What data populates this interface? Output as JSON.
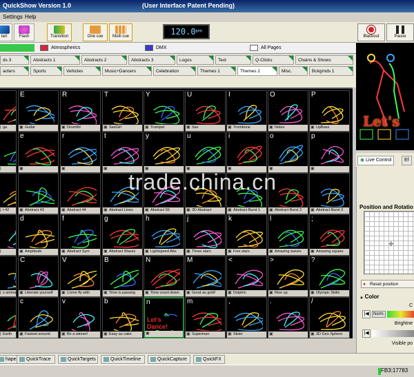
{
  "app": {
    "title": "QuickShow   Version 1.0",
    "subtitle": "(User Interface Patent Pending)"
  },
  "menu": [
    "Settings",
    "Help"
  ],
  "toolbar": {
    "buttons": [
      {
        "label": "tart",
        "icon": "start-icon"
      },
      {
        "label": "Flash",
        "icon": "flash-icon"
      },
      {
        "label": "Transition",
        "icon": "transition-icon"
      },
      {
        "label": "One cue",
        "icon": "one-cue-icon"
      },
      {
        "label": "Multi cue",
        "icon": "multi-cue-icon"
      }
    ],
    "bpm": "120.0",
    "bpm_unit": "BPM"
  },
  "right_buttons": [
    {
      "label": "Blackout",
      "icon": "blackout-icon"
    },
    {
      "label": "Pause",
      "icon": "pause-icon"
    }
  ],
  "categories": [
    {
      "label": "Atmospherics",
      "color": "#d22a3a"
    },
    {
      "label": "DMX",
      "color": "#3a3ac8"
    },
    {
      "label": "All Pages",
      "color": "#ffffff"
    }
  ],
  "tab_row1": [
    "ds 3",
    "Abstracts 1",
    "Abstracts 2",
    "Abstracts 3",
    "Logos",
    "Text",
    "Q-Clicks",
    "Chains & Shows"
  ],
  "tab_row2": [
    "acters",
    "Sports",
    "Vehicles",
    "Music+Dancers",
    "Celebration",
    "Themes 1",
    "Themes 2",
    "Misc.",
    "Bckgrnds 1"
  ],
  "active_tab": "Themes 2",
  "grid": [
    [
      {
        "key": "",
        "label": "ga"
      },
      {
        "key": "E",
        "label": "Guitar"
      },
      {
        "key": "R",
        "label": "DrumKit"
      },
      {
        "key": "T",
        "label": "SaxGirl"
      },
      {
        "key": "Y",
        "label": "Trumpet"
      },
      {
        "key": "U",
        "label": "Sax"
      },
      {
        "key": "I",
        "label": "Trombone"
      },
      {
        "key": "O",
        "label": "Notes"
      },
      {
        "key": "P",
        "label": "UpBass"
      }
    ],
    [
      {
        "key": "",
        "label": ""
      },
      {
        "key": "e",
        "label": ""
      },
      {
        "key": "r",
        "label": ""
      },
      {
        "key": "t",
        "label": ""
      },
      {
        "key": "y",
        "label": ""
      },
      {
        "key": "u",
        "label": ""
      },
      {
        "key": "i",
        "label": ""
      },
      {
        "key": "o",
        "label": ""
      },
      {
        "key": "p",
        "label": ""
      }
    ],
    [
      {
        "key": "",
        "label": "t 42"
      },
      {
        "key": "",
        "label": "Abstract 43"
      },
      {
        "key": "",
        "label": "Abstract 44"
      },
      {
        "key": "",
        "label": "Abstract Lines"
      },
      {
        "key": "",
        "label": "Abstract 56"
      },
      {
        "key": "",
        "label": "3D Abstract"
      },
      {
        "key": "",
        "label": "Abstract Burst 1"
      },
      {
        "key": "",
        "label": "Abstract Burst 2"
      },
      {
        "key": "",
        "label": "Abstract Burst 3"
      }
    ],
    [
      {
        "key": "",
        "label": ""
      },
      {
        "key": "d",
        "label": "Amplitude"
      },
      {
        "key": "f",
        "label": "Abstract Sym"
      },
      {
        "key": "g",
        "label": "Abstract Waves"
      },
      {
        "key": "h",
        "label": "Lightspeed Abs"
      },
      {
        "key": "j",
        "label": "Three stars"
      },
      {
        "key": "k",
        "label": "Five stars"
      },
      {
        "key": "l",
        "label": "Amazing waves"
      },
      {
        "key": ";",
        "label": "Amazing square"
      }
    ],
    [
      {
        "key": "",
        "label": "s animal"
      },
      {
        "key": "C",
        "label": "Liberate yourself"
      },
      {
        "key": "V",
        "label": "Come fly with"
      },
      {
        "key": "B",
        "label": "Time is passing"
      },
      {
        "key": "N",
        "label": "Time count down"
      },
      {
        "key": "M",
        "label": "Good as gold!"
      },
      {
        "key": "<",
        "label": "Dolphin"
      },
      {
        "key": ">",
        "label": "Rise up"
      },
      {
        "key": "?",
        "label": "Olympic Skills"
      }
    ],
    [
      {
        "key": "",
        "label": "Earth"
      },
      {
        "key": "c",
        "label": "Fastest around"
      },
      {
        "key": "v",
        "label": "Be a winner!"
      },
      {
        "key": "b",
        "label": "Easy as cake"
      },
      {
        "key": "n",
        "label": ""
      },
      {
        "key": "m",
        "label": "Superman"
      },
      {
        "key": ",",
        "label": "Skiier"
      },
      {
        "key": ".",
        "label": ""
      },
      {
        "key": "/",
        "label": "3D Geo Sphere"
      }
    ]
  ],
  "selected_cell_text": "Let's Dance!",
  "watermark": "trade.china.cn",
  "preview_text": "Let's",
  "panel_tabs": [
    "Live Control",
    "Ef"
  ],
  "panel_sections": {
    "position": "Position and Rotatio",
    "reset": "Reset position",
    "color": "Color"
  },
  "color_rows": [
    {
      "label": "C",
      "button": "Norm."
    },
    {
      "label": "Brightne"
    },
    {
      "label": "Visible po"
    }
  ],
  "bottom_tabs": [
    "hape",
    "QuickTrace",
    "QuickTargets",
    "QuickTimeline",
    "QuickCapture",
    "QuickFX"
  ],
  "status": {
    "fb": "FB3:17783"
  }
}
